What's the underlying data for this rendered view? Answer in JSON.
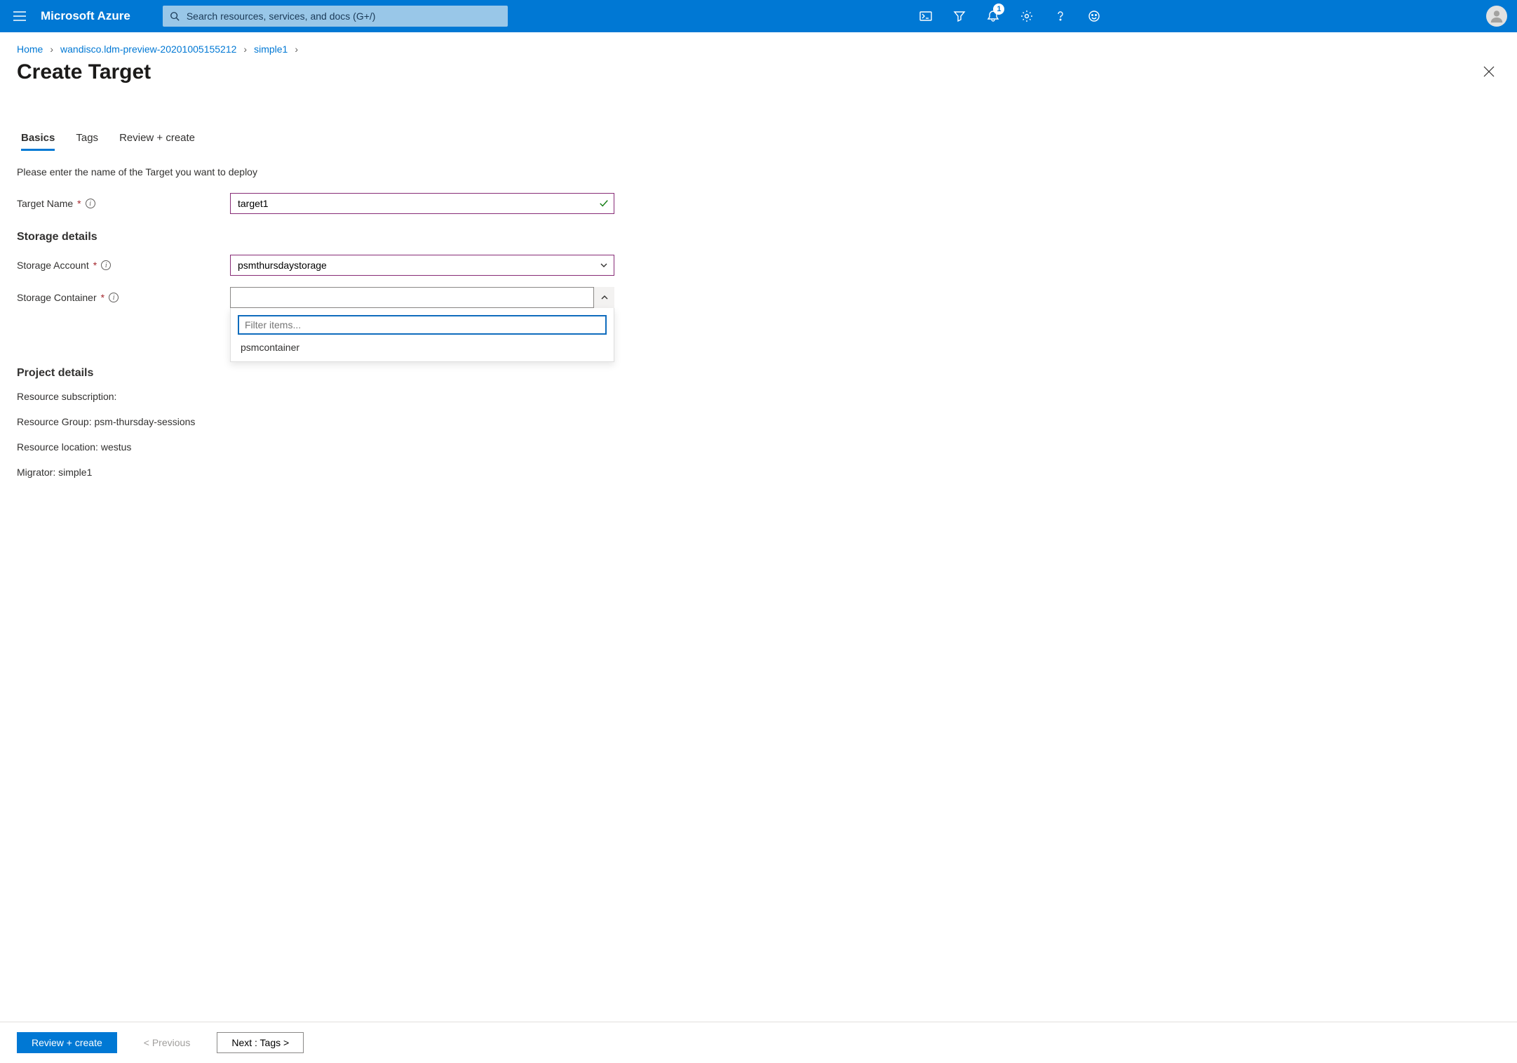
{
  "brand": "Microsoft Azure",
  "search": {
    "placeholder": "Search resources, services, and docs (G+/)"
  },
  "notifications": {
    "count": "1"
  },
  "breadcrumb": {
    "items": [
      "Home",
      "wandisco.ldm-preview-20201005155212",
      "simple1"
    ]
  },
  "page": {
    "title": "Create Target"
  },
  "tabs": [
    "Basics",
    "Tags",
    "Review + create"
  ],
  "form": {
    "intro": "Please enter the name of the Target you want to deploy",
    "target_name_label": "Target Name",
    "target_name_value": "target1",
    "storage_heading": "Storage details",
    "storage_account_label": "Storage Account",
    "storage_account_value": "psmthursdaystorage",
    "storage_container_label": "Storage Container",
    "storage_container_value": "",
    "filter_placeholder": "Filter items...",
    "dd_options": [
      "psmcontainer"
    ],
    "project_heading": "Project details",
    "resource_subscription": "Resource subscription:",
    "resource_group": "Resource Group: psm-thursday-sessions",
    "resource_location": "Resource location: westus",
    "migrator": "Migrator: simple1"
  },
  "footer": {
    "review": "Review + create",
    "previous": "< Previous",
    "next": "Next : Tags >"
  }
}
